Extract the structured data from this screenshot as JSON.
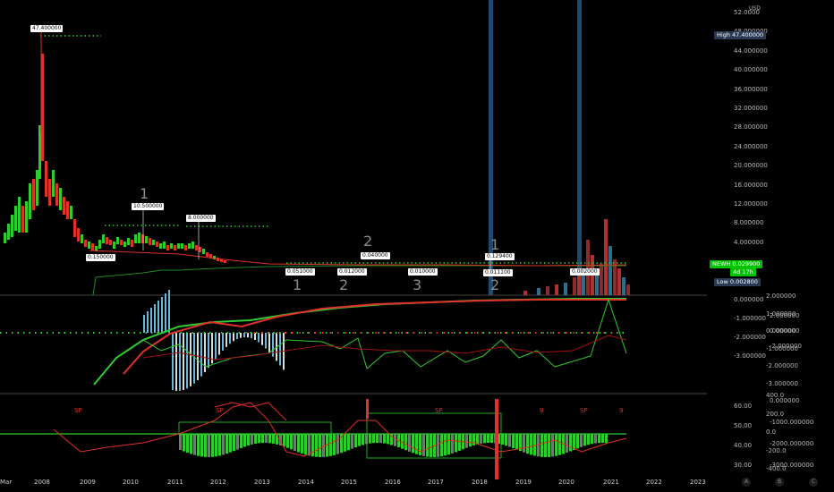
{
  "currency": "USD",
  "main_axis": [
    "52.0000",
    "48.000000",
    "44.000000",
    "40.000000",
    "36.000000",
    "32.000000",
    "28.000000",
    "24.000000",
    "20.000000",
    "16.000000",
    "12.000000",
    "8.000000",
    "4.000000"
  ],
  "price_tags": {
    "high_label": "High",
    "high_value": "47.400000",
    "newh_label": "NEWH",
    "newh_value": "0.029900",
    "newh_time": "4d 17h",
    "low_label": "Low",
    "low_value": "0.002800"
  },
  "price_labels": [
    "47.400000",
    "10.500000",
    "8.000000",
    "0.150000",
    "0.051000",
    "0.040000",
    "0.012000",
    "0.010000",
    "0.129400",
    "0.011100",
    "0.002000"
  ],
  "wave_labels": [
    "1",
    "2",
    "1",
    "2",
    "3",
    "1",
    "2"
  ],
  "osc1_axis_left": [
    "0.000000",
    "-1.000000",
    "-2.000000",
    "-3.000000"
  ],
  "osc1_axis_mid": [
    "2.000000",
    "1.000000",
    "0.000000",
    "-1.000000",
    "-2.000000",
    "-3.000000"
  ],
  "osc1_axis_right": [
    "2.000000",
    "0.000000",
    "-2.000000"
  ],
  "osc2_axis_left": [
    "60.00",
    "50.00",
    "40.00",
    "30.00"
  ],
  "osc2_axis_mid": [
    "400.0",
    "200.0",
    "0.0",
    "-200.0",
    "-400.0"
  ],
  "osc2_axis_right": [
    "0.000000",
    "-1000.000000",
    "-2000.000000",
    "-3000.000000"
  ],
  "osc2_markers": [
    "SP",
    "SP",
    "SP",
    "SP",
    "9",
    "9"
  ],
  "x_axis": [
    "Mar",
    "2008",
    "2009",
    "2010",
    "2011",
    "2012",
    "2013",
    "2014",
    "2015",
    "2016",
    "2017",
    "2018",
    "2019",
    "2020",
    "2021",
    "2022",
    "2023"
  ],
  "bottom_buttons": [
    "A",
    "B",
    "C"
  ],
  "colors": {
    "up": "#2ecc2e",
    "down": "#e0312b",
    "accent": "#00c300",
    "tag_bg": "#2a3a55",
    "highlight": "#1d4a6e"
  }
}
